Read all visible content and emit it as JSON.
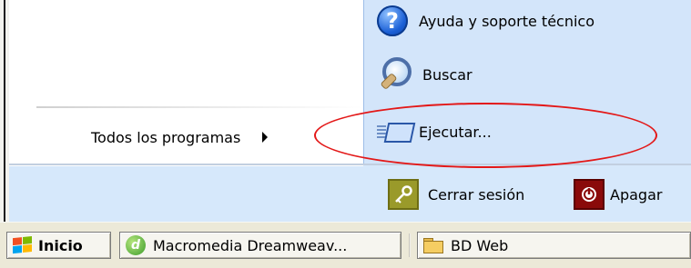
{
  "start_menu": {
    "all_programs_label": "Todos los programas",
    "right_items": [
      {
        "label": "Ayuda y soporte técnico",
        "icon": "help-icon"
      },
      {
        "label": "Buscar",
        "icon": "search-icon"
      },
      {
        "label": "Ejecutar...",
        "icon": "run-icon"
      }
    ],
    "logoff_label": "Cerrar sesión",
    "shutdown_label": "Apagar"
  },
  "taskbar": {
    "start_label": "Inicio",
    "tasks": [
      {
        "label": "Macromedia Dreamweav...",
        "icon": "dreamweaver-icon"
      },
      {
        "label": "BD Web",
        "icon": "folder-icon"
      }
    ]
  },
  "help_icon_glyph": "?",
  "dreamweaver_glyph": "d",
  "colors": {
    "highlight_ellipse": "#e31818",
    "right_pane": "#d3e5fa",
    "taskbar": "#ece9d8"
  }
}
